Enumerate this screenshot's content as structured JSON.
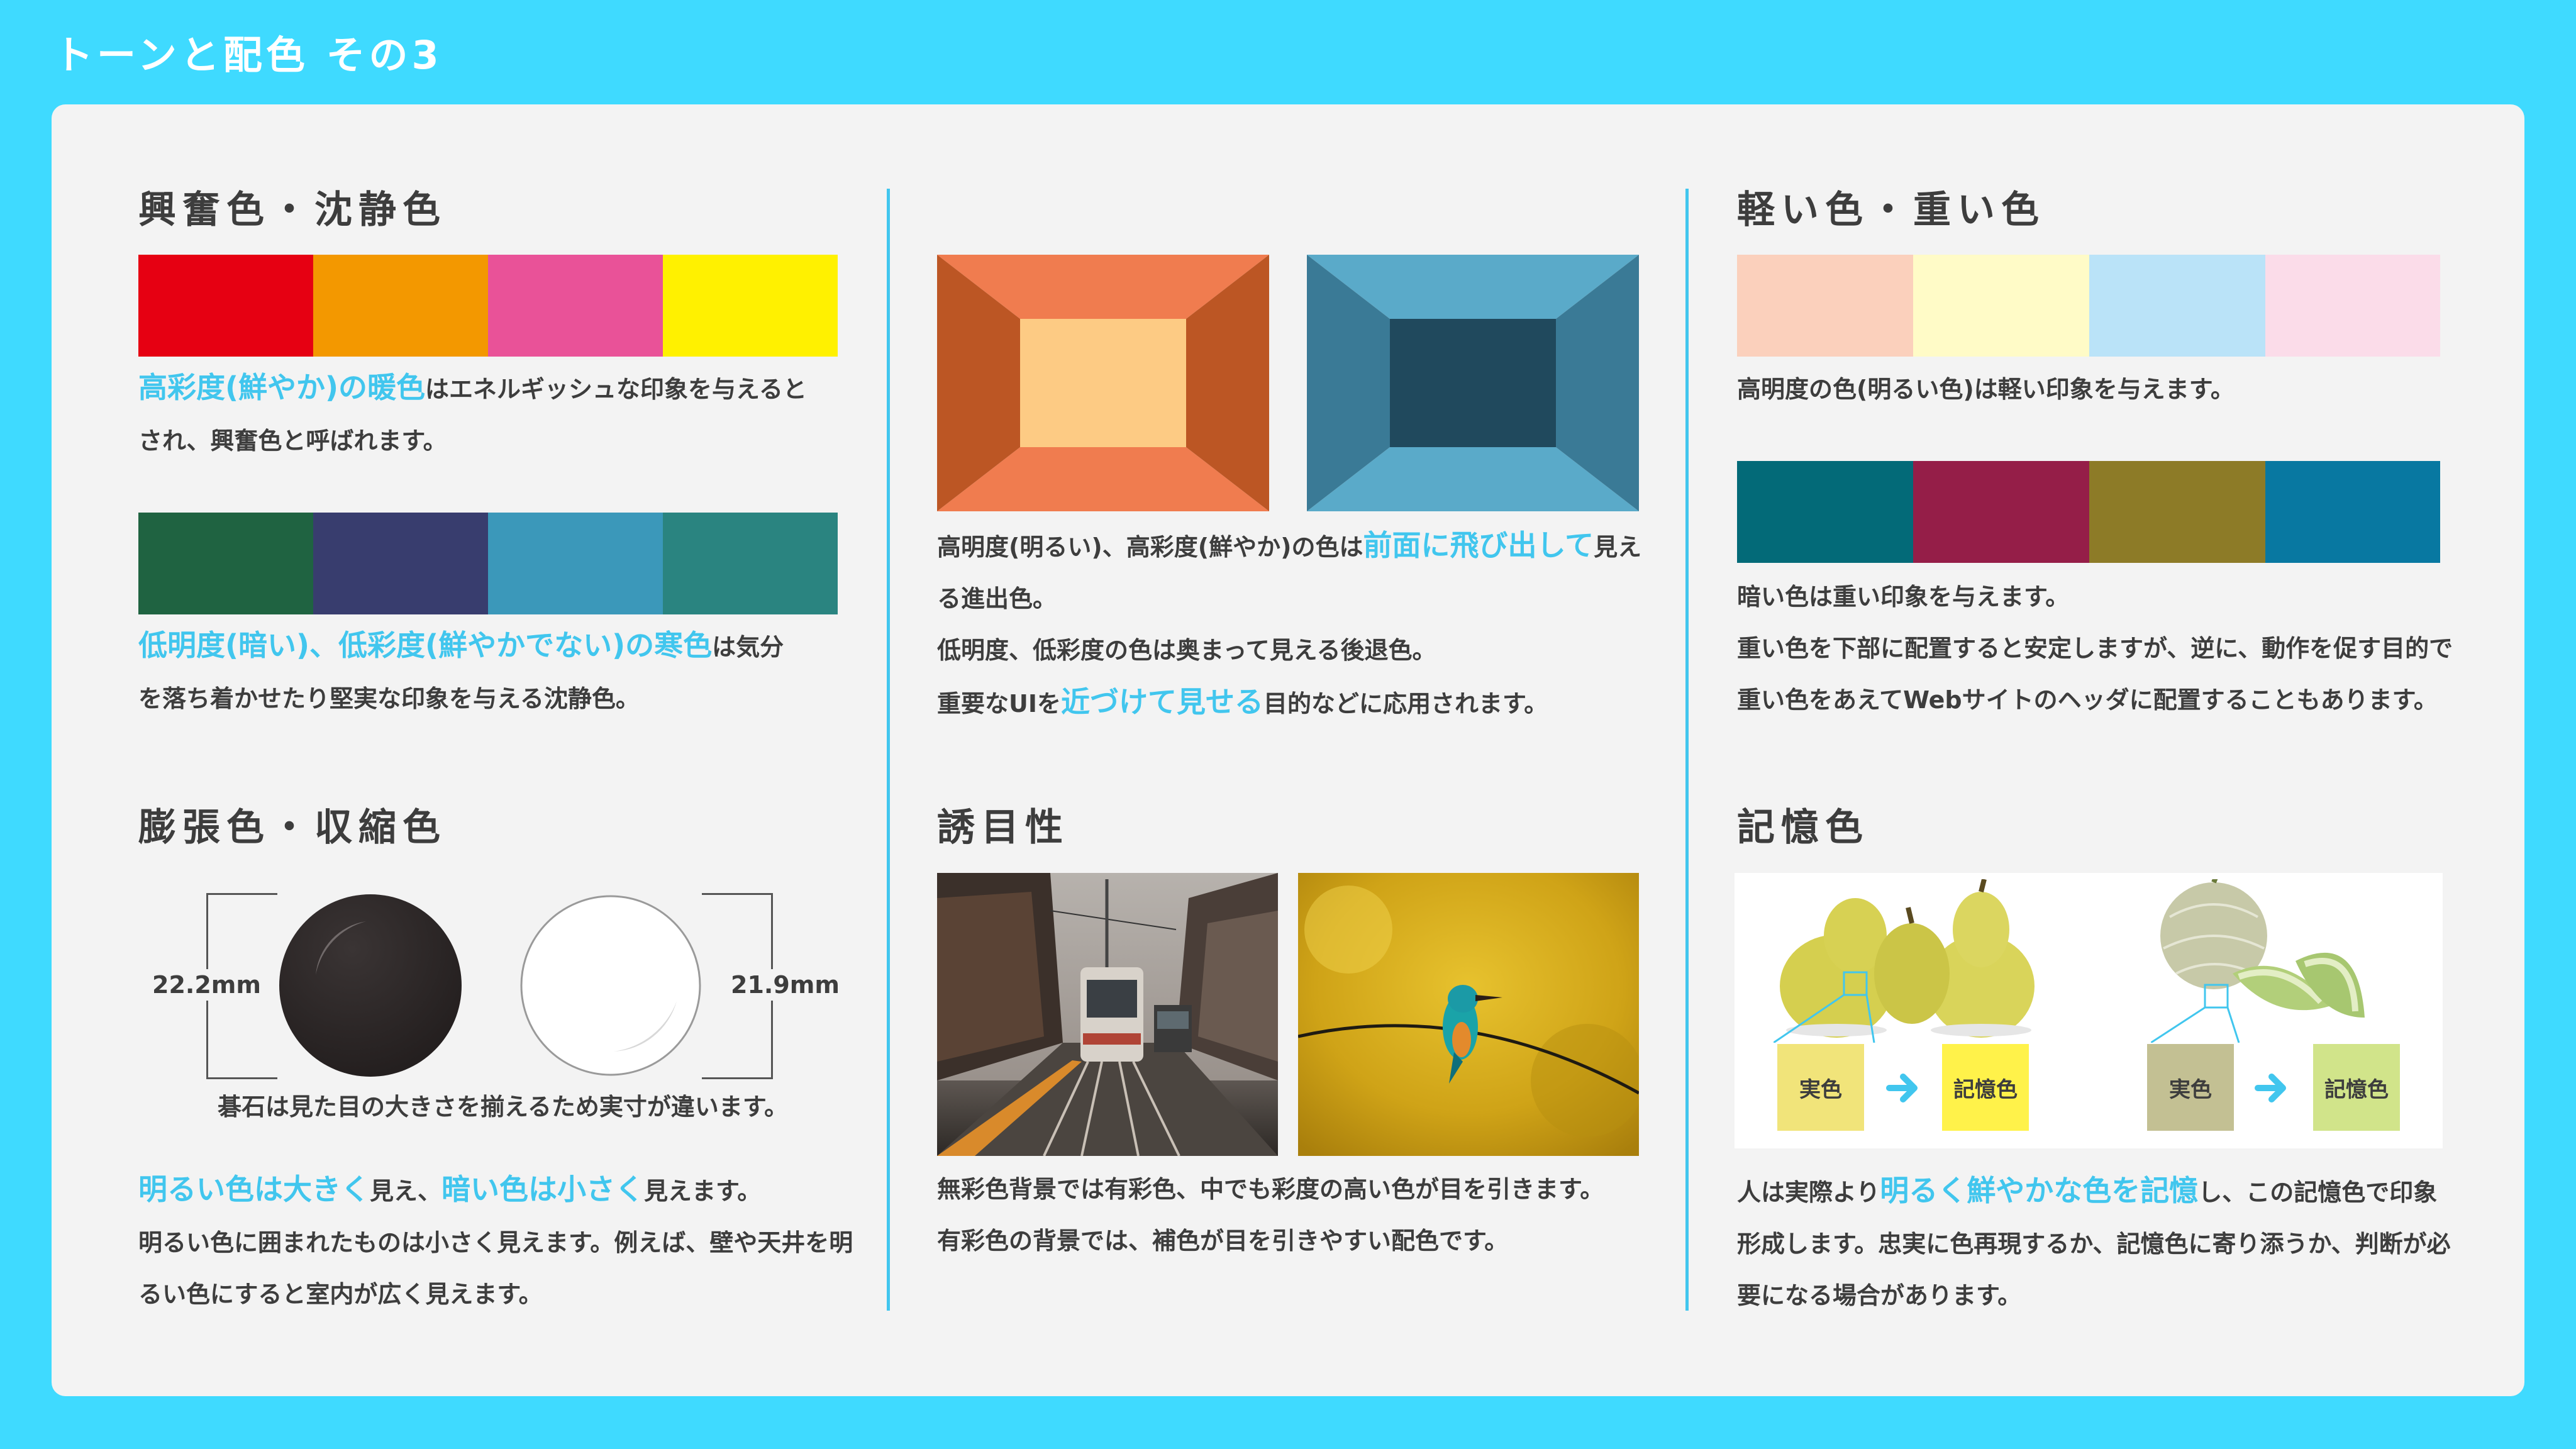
{
  "page": {
    "title": "トーンと配色 その3"
  },
  "colors": {
    "background": "#3fdaff",
    "card": "#f3f3f3",
    "accent": "#41c6ee",
    "text": "#3d3d3d"
  },
  "section_excite": {
    "title": "興奮色・沈静色",
    "warm_swatches": [
      "#e60012",
      "#f39800",
      "#e95298",
      "#fff100"
    ],
    "warm_text": {
      "hl": "高彩度(鮮やか)の暖色",
      "rest1": "はエネルギッシュな印象を与えると",
      "line2": "され、興奮色と呼ばれます。"
    },
    "cool_swatches": [
      "#1f6341",
      "#383d6e",
      "#3b98ba",
      "#2a8480"
    ],
    "cool_text": {
      "hl": "低明度(暗い)、低彩度(鮮やかでない)の寒色",
      "rest1": "は気分",
      "line2": "を落ち着かせたり堅実な印象を与える沈静色。"
    }
  },
  "section_advance": {
    "rooms": [
      {
        "top": "#f07c4f",
        "side": "#bc5624",
        "back": "#fdcb84"
      },
      {
        "top": "#5aaac9",
        "side": "#3a7a96",
        "back": "#20495d"
      }
    ],
    "text": {
      "l1a": "高明度(明るい)、高彩度(鮮やか)の色は",
      "l1hl": "前面に飛び出して",
      "l1b": "見え",
      "l2": "る進出色。",
      "l3": "低明度、低彩度の色は奥まって見える後退色。",
      "l4a": "重要なUIを",
      "l4hl": "近づけて見せる",
      "l4b": "目的などに応用されます。"
    }
  },
  "section_weight": {
    "title": "軽い色・重い色",
    "light_swatches": [
      "#fbd0bc",
      "#fffbc7",
      "#bae3f8",
      "#fbdce9"
    ],
    "light_text": "高明度の色(明るい色)は軽い印象を与えます。",
    "heavy_swatches": [
      "#036a78",
      "#951e48",
      "#8d7b27",
      "#0878a1"
    ],
    "heavy_text": {
      "l1": "暗い色は重い印象を与えます。",
      "l2": "重い色を下部に配置すると安定しますが、逆に、動作を促す目的で",
      "l3": "重い色をあえてWebサイトのヘッダに配置することもあります。"
    }
  },
  "section_expand": {
    "title": "膨張色・収縮色",
    "black_label": "22.2mm",
    "white_label": "21.9mm",
    "caption": "碁石は見た目の大きさを揃えるため実寸が違います。",
    "text": {
      "hl1": "明るい色は大きく",
      "mid1": "見え、",
      "hl2": "暗い色は小さく",
      "mid2": "見えます。",
      "l2": "明るい色に囲まれたものは小さく見えます。例えば、壁や天井を明",
      "l3": "るい色にすると室内が広く見えます。"
    }
  },
  "section_attract": {
    "title": "誘目性",
    "text": {
      "l1": "無彩色背景では有彩色、中でも彩度の高い色が目を引きます。",
      "l2": "有彩色の背景では、補色が目を引きやすい配色です。"
    }
  },
  "section_memory": {
    "title": "記憶色",
    "pear": {
      "real": "実色",
      "memory": "記憶色",
      "real_color": "#f1e47a",
      "memory_color": "#fff24a"
    },
    "melon": {
      "real": "実色",
      "memory": "記憶色",
      "real_color": "#c3c093",
      "memory_color": "#d1e48a"
    },
    "text": {
      "a": "人は実際より",
      "hl": "明るく鮮やかな色を記憶",
      "b": "し、この記憶色で印象",
      "l2": "形成します。忠実に色再現するか、記憶色に寄り添うか、判断が必",
      "l3": "要になる場合があります。"
    }
  }
}
